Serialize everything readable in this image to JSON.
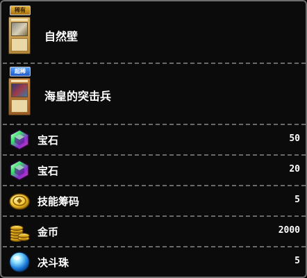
{
  "cards": [
    {
      "badge": "稀有",
      "name": "自然壁"
    },
    {
      "badge": "超稀",
      "name": "海皇的突击兵"
    }
  ],
  "items": [
    {
      "icon": "gem-icon",
      "label": "宝石",
      "quantity": "50"
    },
    {
      "icon": "gem-icon",
      "label": "宝石",
      "quantity": "20"
    },
    {
      "icon": "skill-chip-icon",
      "label": "技能筹码",
      "quantity": "5"
    },
    {
      "icon": "gold-coins-icon",
      "label": "金币",
      "quantity": "2000"
    },
    {
      "icon": "duel-orb-icon",
      "label": "决斗珠",
      "quantity": "5"
    }
  ],
  "colors": {
    "background": "#0b0b0b",
    "border": "#6e6e6e",
    "separator": "#6a6a6a",
    "badge_rare": "#e7b43a",
    "badge_super_rare": "#2f7be6"
  }
}
